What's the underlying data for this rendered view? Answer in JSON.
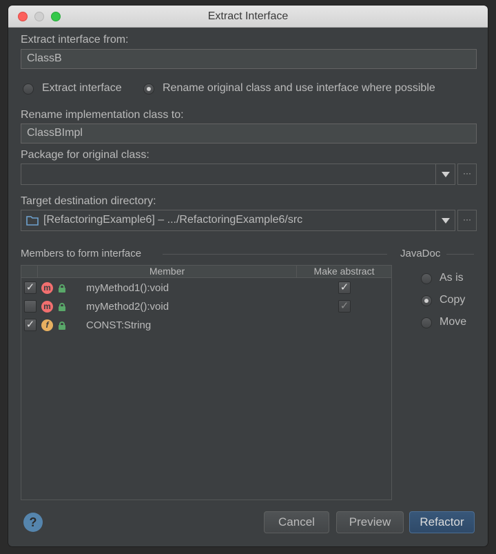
{
  "dialog": {
    "title": "Extract Interface",
    "extract_from_label": "Extract interface from:",
    "extract_from_value": "ClassB",
    "radio_extract_label": "Extract interface",
    "radio_rename_label": "Rename original class and use interface where possible",
    "rename_impl_label": "Rename implementation class to:",
    "rename_impl_value": "ClassBImpl",
    "package_label": "Package for original class:",
    "package_value": "",
    "target_dir_label": "Target destination directory:",
    "target_dir_value": "[RefactoringExample6] – .../RefactoringExample6/src",
    "browse_label": "···",
    "members_group_label": "Members to form interface",
    "javadoc_group_label": "JavaDoc",
    "table": {
      "columns": [
        "Member",
        "Make abstract"
      ],
      "rows": [
        {
          "checked": true,
          "kind": "m",
          "name": "myMethod1():void",
          "abstract": true,
          "abstract_enabled": true
        },
        {
          "checked": false,
          "kind": "m",
          "name": "myMethod2():void",
          "abstract": true,
          "abstract_enabled": false
        },
        {
          "checked": true,
          "kind": "f",
          "name": "CONST:String",
          "abstract": null,
          "abstract_enabled": false
        }
      ]
    },
    "javadoc_options": [
      {
        "label": "As is",
        "selected": false
      },
      {
        "label": "Copy",
        "selected": true
      },
      {
        "label": "Move",
        "selected": false
      }
    ],
    "buttons": {
      "cancel": "Cancel",
      "preview": "Preview",
      "refactor": "Refactor"
    },
    "help": "?"
  },
  "colors": {
    "accent_button": "#365880",
    "method_badge": "#f26f6f",
    "field_badge": "#e8b060",
    "lock": "#59a869"
  }
}
